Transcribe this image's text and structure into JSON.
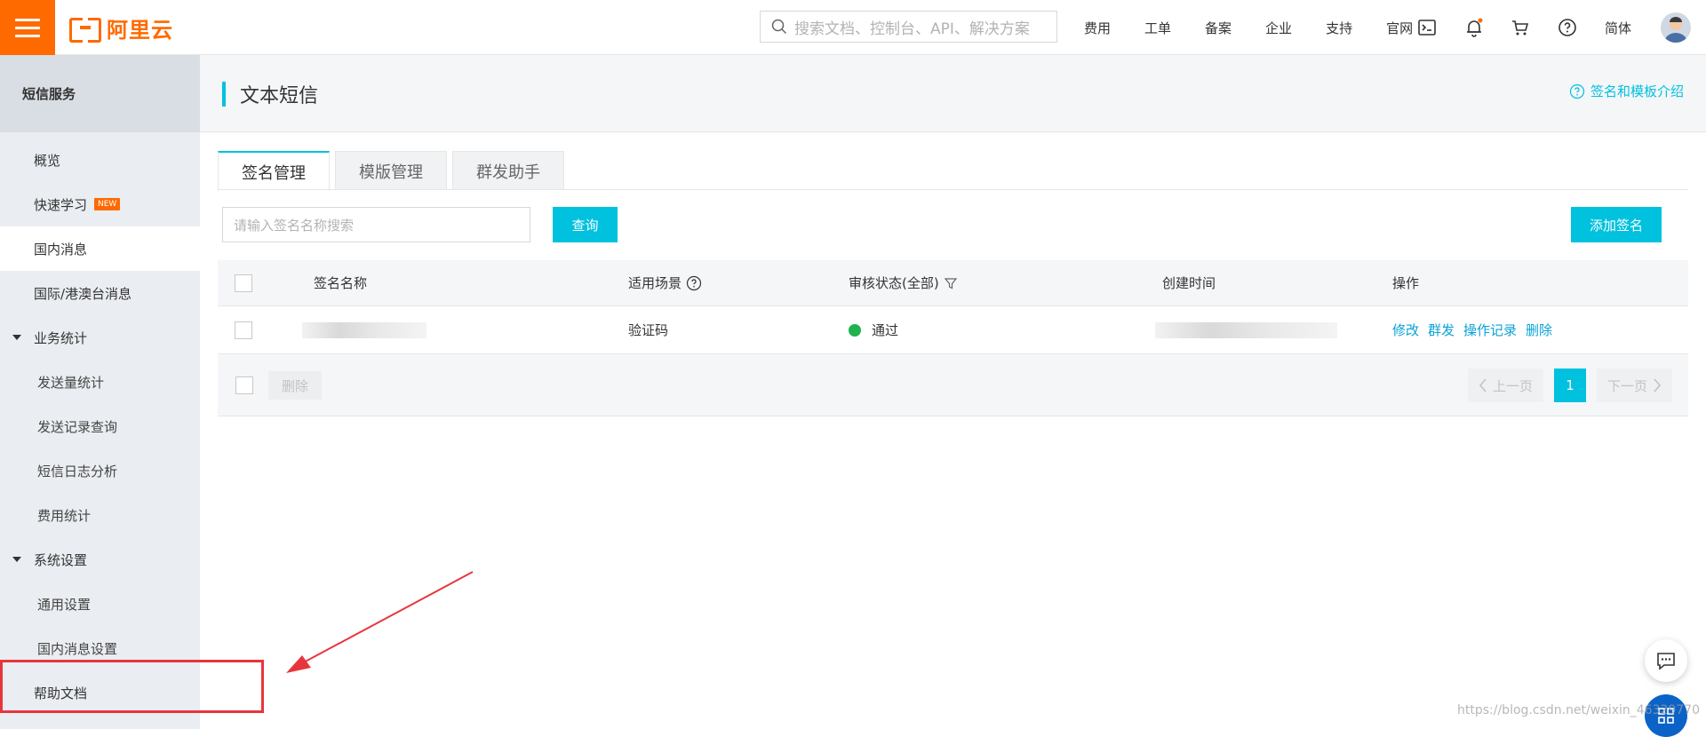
{
  "brand": {
    "logo_text": "阿里云",
    "accent": "#ff6a00",
    "primary": "#00c1de"
  },
  "topbar": {
    "search_placeholder": "搜索文档、控制台、API、解决方案",
    "links": [
      "费用",
      "工单",
      "备案",
      "企业",
      "支持",
      "官网"
    ],
    "lang": "简体"
  },
  "sidebar": {
    "title": "短信服务",
    "items": [
      {
        "label": "概览",
        "type": "item"
      },
      {
        "label": "快速学习",
        "type": "item",
        "badge": "NEW"
      },
      {
        "label": "国内消息",
        "type": "item",
        "active": true
      },
      {
        "label": "国际/港澳台消息",
        "type": "item"
      },
      {
        "label": "业务统计",
        "type": "group"
      },
      {
        "label": "发送量统计",
        "type": "sub"
      },
      {
        "label": "发送记录查询",
        "type": "sub"
      },
      {
        "label": "短信日志分析",
        "type": "sub"
      },
      {
        "label": "费用统计",
        "type": "sub"
      },
      {
        "label": "系统设置",
        "type": "group"
      },
      {
        "label": "通用设置",
        "type": "sub"
      },
      {
        "label": "国内消息设置",
        "type": "sub"
      },
      {
        "label": "帮助文档",
        "type": "item"
      }
    ]
  },
  "page": {
    "title": "文本短信",
    "help_link": "签名和模板介绍",
    "tabs": [
      "签名管理",
      "模版管理",
      "群发助手"
    ],
    "search_placeholder": "请输入签名名称搜索",
    "query_button": "查询",
    "add_button": "添加签名"
  },
  "table": {
    "columns": [
      "签名名称",
      "适用场景",
      "审核状态(全部)",
      "创建时间",
      "操作"
    ],
    "rows": [
      {
        "scene": "验证码",
        "status": "通过",
        "actions": [
          "修改",
          "群发",
          "操作记录",
          "删除"
        ]
      }
    ],
    "delete_button": "删除",
    "pager": {
      "prev": "上一页",
      "current": "1",
      "next": "下一页"
    }
  },
  "watermark": "https://blog.csdn.net/weixin_46329770"
}
